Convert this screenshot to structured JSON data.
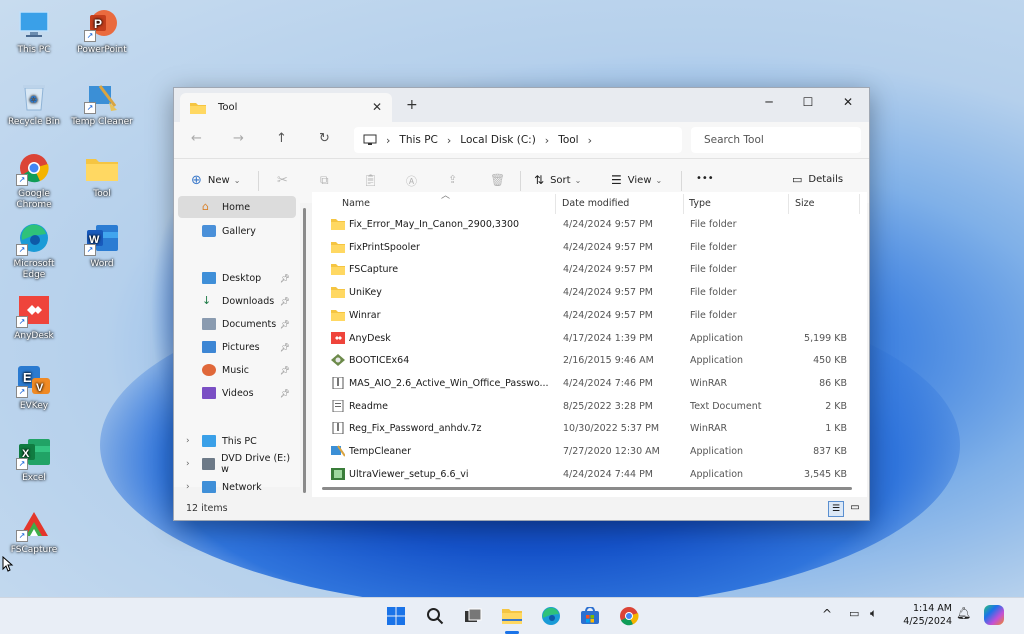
{
  "desktop": {
    "icons": [
      {
        "label": "This PC",
        "icon": "monitor-icon"
      },
      {
        "label": "PowerPoint",
        "icon": "powerpoint-icon"
      },
      {
        "label": "Recycle Bin",
        "icon": "recycle-bin-icon"
      },
      {
        "label": "Temp Cleaner",
        "icon": "temp-cleaner-icon"
      },
      {
        "label": "Google Chrome",
        "icon": "chrome-icon"
      },
      {
        "label": "Tool",
        "icon": "folder-icon"
      },
      {
        "label": "Microsoft Edge",
        "icon": "edge-icon"
      },
      {
        "label": "Word",
        "icon": "word-icon"
      },
      {
        "label": "AnyDesk",
        "icon": "anydesk-icon"
      },
      {
        "label": "EVKey",
        "icon": "evkey-icon"
      },
      {
        "label": "Excel",
        "icon": "excel-icon"
      },
      {
        "label": "FSCapture",
        "icon": "fscapture-icon"
      }
    ]
  },
  "explorer": {
    "tab_title": "Tool",
    "breadcrumb": [
      "This PC",
      "Local Disk (C:)",
      "Tool"
    ],
    "search_placeholder": "Search Tool",
    "toolbar": {
      "new_label": "New",
      "sort_label": "Sort",
      "view_label": "View",
      "more_label": "•••",
      "details_label": "Details"
    },
    "sidebar": {
      "home": "Home",
      "gallery": "Gallery",
      "quick": [
        {
          "label": "Desktop",
          "icon": "desktop-icon"
        },
        {
          "label": "Downloads",
          "icon": "downloads-icon"
        },
        {
          "label": "Documents",
          "icon": "documents-icon"
        },
        {
          "label": "Pictures",
          "icon": "pictures-icon"
        },
        {
          "label": "Music",
          "icon": "music-icon"
        },
        {
          "label": "Videos",
          "icon": "videos-icon"
        }
      ],
      "drives": [
        {
          "label": "This PC",
          "icon": "this-pc-icon"
        },
        {
          "label": "DVD Drive (E:) w",
          "icon": "dvd-drive-icon"
        },
        {
          "label": "Network",
          "icon": "network-icon"
        }
      ]
    },
    "columns": {
      "name": "Name",
      "date": "Date modified",
      "type": "Type",
      "size": "Size"
    },
    "files": [
      {
        "name": "Fix_Error_May_In_Canon_2900,3300",
        "date": "4/24/2024 9:57 PM",
        "type": "File folder",
        "size": "",
        "icon": "folder-icon"
      },
      {
        "name": "FixPrintSpooler",
        "date": "4/24/2024 9:57 PM",
        "type": "File folder",
        "size": "",
        "icon": "folder-icon"
      },
      {
        "name": "FSCapture",
        "date": "4/24/2024 9:57 PM",
        "type": "File folder",
        "size": "",
        "icon": "folder-icon"
      },
      {
        "name": "UniKey",
        "date": "4/24/2024 9:57 PM",
        "type": "File folder",
        "size": "",
        "icon": "folder-icon"
      },
      {
        "name": "Winrar",
        "date": "4/24/2024 9:57 PM",
        "type": "File folder",
        "size": "",
        "icon": "folder-icon"
      },
      {
        "name": "AnyDesk",
        "date": "4/17/2024 1:39 PM",
        "type": "Application",
        "size": "5,199 KB",
        "icon": "anydesk-icon"
      },
      {
        "name": "BOOTICEx64",
        "date": "2/16/2015 9:46 AM",
        "type": "Application",
        "size": "450 KB",
        "icon": "bootice-icon"
      },
      {
        "name": "MAS_AIO_2.6_Active_Win_Office_Passwo...",
        "date": "4/24/2024 7:46 PM",
        "type": "WinRAR",
        "size": "86 KB",
        "icon": "archive-icon"
      },
      {
        "name": "Readme",
        "date": "8/25/2022 3:28 PM",
        "type": "Text Document",
        "size": "2 KB",
        "icon": "text-file-icon"
      },
      {
        "name": "Reg_Fix_Password_anhdv.7z",
        "date": "10/30/2022 5:37 PM",
        "type": "WinRAR",
        "size": "1 KB",
        "icon": "archive-icon"
      },
      {
        "name": "TempCleaner",
        "date": "7/27/2020 12:30 AM",
        "type": "Application",
        "size": "837 KB",
        "icon": "temp-cleaner-icon"
      },
      {
        "name": "UltraViewer_setup_6.6_vi",
        "date": "4/24/2024 7:44 PM",
        "type": "Application",
        "size": "3,545 KB",
        "icon": "ultraviewer-icon"
      }
    ],
    "status": "12 items"
  },
  "taskbar": {
    "time": "1:14 AM",
    "date": "4/25/2024"
  }
}
